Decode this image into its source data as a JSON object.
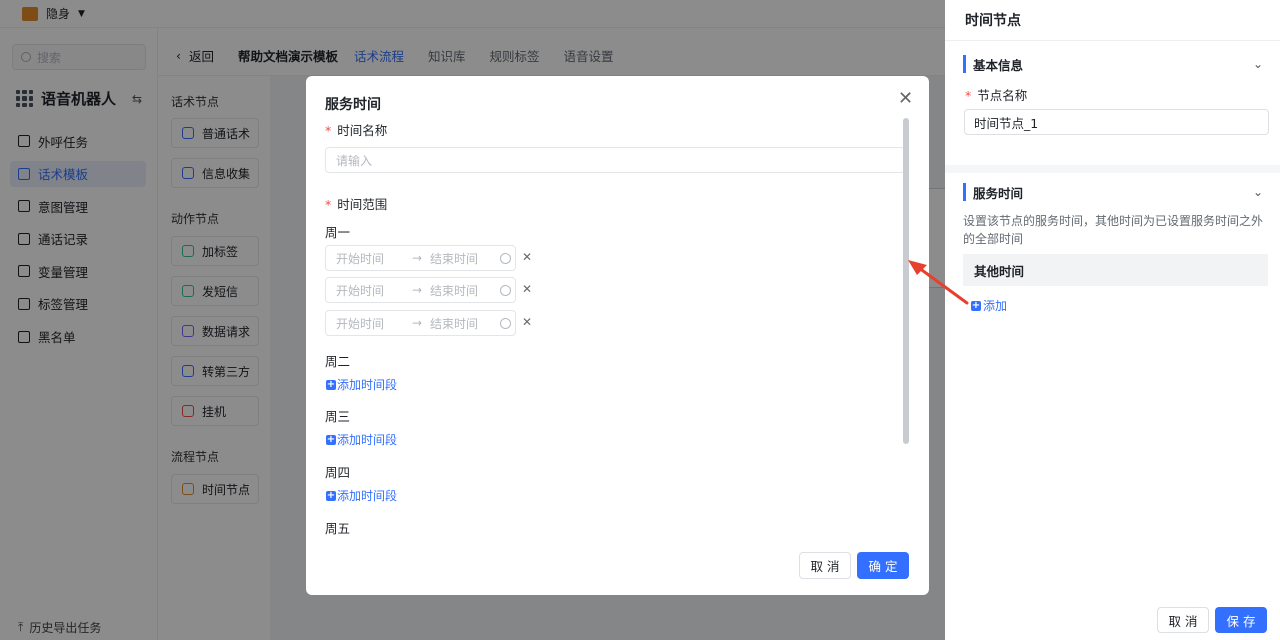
{
  "topbar": {
    "status": "隐身"
  },
  "sidebar": {
    "search_placeholder": "搜索",
    "app_title": "语音机器人",
    "items": [
      {
        "label": "外呼任务",
        "icon": "phone-icon"
      },
      {
        "label": "话术模板",
        "icon": "document-icon",
        "active": true
      },
      {
        "label": "意图管理",
        "icon": "intent-icon"
      },
      {
        "label": "通话记录",
        "icon": "record-icon"
      },
      {
        "label": "变量管理",
        "icon": "variable-icon"
      },
      {
        "label": "标签管理",
        "icon": "tag-icon"
      },
      {
        "label": "黑名单",
        "icon": "user-block-icon"
      }
    ],
    "footer": "历史导出任务"
  },
  "header": {
    "back_label": "返回",
    "template_name": "帮助文档演示模板",
    "tabs": [
      {
        "label": "话术流程",
        "active": true
      },
      {
        "label": "知识库"
      },
      {
        "label": "规则标签"
      },
      {
        "label": "语音设置"
      }
    ]
  },
  "palette": {
    "groups": [
      {
        "title": "话术节点",
        "items": [
          "普通话术",
          "信息收集"
        ]
      },
      {
        "title": "动作节点",
        "items": [
          "加标签",
          "发短信",
          "数据请求",
          "转第三方",
          "挂机"
        ]
      },
      {
        "title": "流程节点",
        "items": [
          "时间节点"
        ]
      }
    ]
  },
  "drawer": {
    "title": "时间节点",
    "basic_section": "基本信息",
    "node_name_label": "节点名称",
    "node_name_value": "时间节点_1",
    "service_section": "服务时间",
    "description": "设置该节点的服务时间，其他时间为已设置服务时间之外的全部时间",
    "other_time": "其他时间",
    "add_label": "添加",
    "cancel_label": "取 消",
    "save_label": "保 存"
  },
  "modal": {
    "title": "服务时间",
    "name_label": "时间名称",
    "name_placeholder": "请输入",
    "range_label": "时间范围",
    "start_placeholder": "开始时间",
    "end_placeholder": "结束时间",
    "days": [
      {
        "label": "周一",
        "slots": 3
      },
      {
        "label": "周二",
        "slots": 0
      },
      {
        "label": "周三",
        "slots": 0
      },
      {
        "label": "周四",
        "slots": 0
      },
      {
        "label": "周五",
        "slots": 0
      }
    ],
    "add_slot_label": "添加时间段",
    "cancel_label": "取 消",
    "ok_label": "确 定"
  },
  "colors": {
    "accent": "#3370ff",
    "required": "#f54a45",
    "annotation_arrow": "#e8402f"
  }
}
